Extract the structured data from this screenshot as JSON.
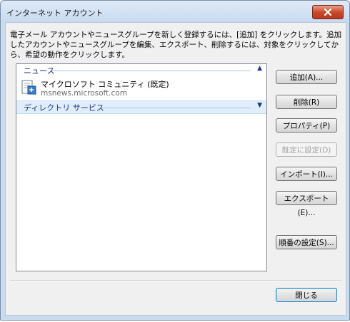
{
  "window": {
    "title": "インターネット アカウント"
  },
  "description": "電子メール アカウントやニュースグループを新しく登録するには、[追加] をクリックします。追加したアカウントやニュースグループを編集、エクスポート、削除するには、対象をクリックしてから、希望の動作をクリックします。",
  "list": {
    "groups": [
      {
        "label": "ニュース",
        "chevron": "▲",
        "accounts": [
          {
            "name": "マイクロソフト コミュニティ (既定)",
            "host": "msnews.microsoft.com",
            "icon": "news-account-icon"
          }
        ]
      },
      {
        "label": "ディレクトリ サービス",
        "chevron": "▼",
        "accounts": []
      }
    ]
  },
  "buttons": {
    "add": "追加(A)...",
    "remove": "削除(R)",
    "properties": "プロパティ(P)",
    "set_default": "既定に設定(D)",
    "import": "インポート(I)...",
    "export": "エクスポート(E)...",
    "order": "順番の設定(S)...",
    "close": "閉じる"
  },
  "colors": {
    "titlebar": "#c7daf0",
    "close_button": "#c94b2c",
    "group_header_text": "#1e3287"
  }
}
